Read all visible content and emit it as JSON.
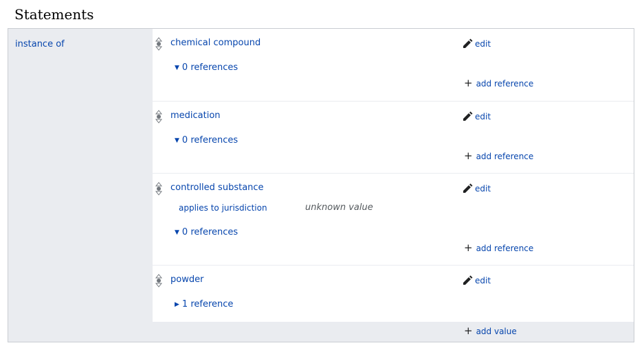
{
  "section_title": "Statements",
  "property": "instance of",
  "edit_label": "edit",
  "add_reference_label": "add reference",
  "add_value_label": "add value",
  "statements": [
    {
      "value": "chemical compound",
      "references": "0 references"
    },
    {
      "value": "medication",
      "references": "0 references"
    },
    {
      "value": "controlled substance",
      "qualifier_property": "applies to jurisdiction",
      "qualifier_value": "unknown value",
      "references": "0 references"
    },
    {
      "value": "powder",
      "references": "1 reference"
    }
  ],
  "icons": {
    "rank": "rank-selector-icon",
    "edit": "pencil-icon",
    "add": "plus-icon",
    "expand": "triangle-icon"
  }
}
